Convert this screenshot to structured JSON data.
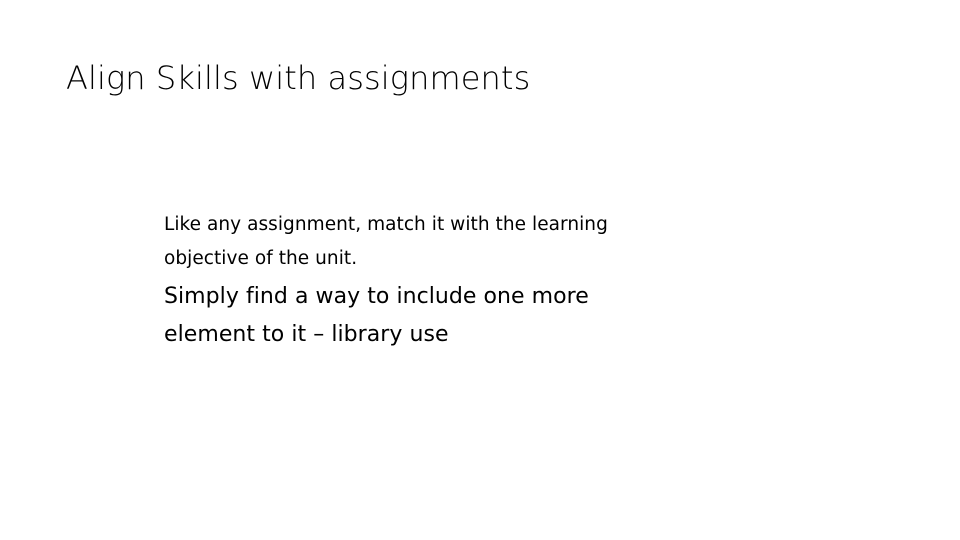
{
  "slide": {
    "background_color": "#FFFFFF",
    "text_color": "#000000",
    "title": "Align Skills with assignments",
    "body": {
      "paragraph_1": {
        "line_1": "Like any assignment, match it with the learning",
        "line_2": "objective of the unit."
      },
      "paragraph_2": {
        "line_1": "Simply find a way to include one more",
        "line_2": "element to it – library use"
      }
    }
  }
}
